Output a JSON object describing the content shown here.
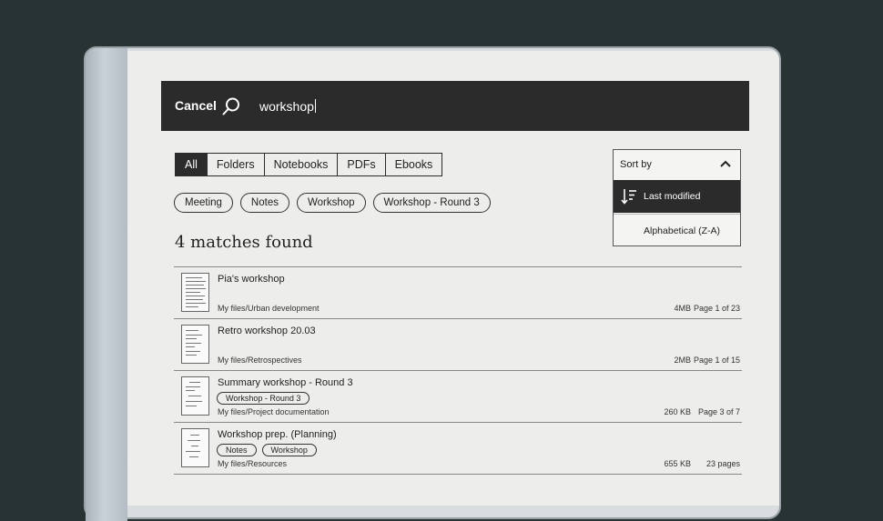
{
  "topbar": {
    "cancel_label": "Cancel",
    "search_query": "workshop"
  },
  "tabs": [
    {
      "label": "All",
      "active": true
    },
    {
      "label": "Folders",
      "active": false
    },
    {
      "label": "Notebooks",
      "active": false
    },
    {
      "label": "PDFs",
      "active": false
    },
    {
      "label": "Ebooks",
      "active": false
    }
  ],
  "chips": [
    "Meeting",
    "Notes",
    "Workshop",
    "Workshop - Round 3"
  ],
  "matches_label": "4 matches found",
  "sort": {
    "label": "Sort by",
    "options": [
      {
        "label": "Last modified",
        "selected": true
      },
      {
        "label": "Alphabetical (Z-A)",
        "selected": false
      }
    ]
  },
  "results": [
    {
      "title": "Pia's workshop",
      "tags": [],
      "path": "My files/Urban development",
      "size": "4MB",
      "pages": "Page 1 of 23"
    },
    {
      "title": "Retro workshop 20.03",
      "tags": [],
      "path": "My files/Retrospectives",
      "size": "2MB",
      "pages": "Page 1 of 15"
    },
    {
      "title": "Summary workshop - Round 3",
      "tags": [
        "Workshop - Round 3"
      ],
      "path": "My files/Project documentation",
      "size": "260 KB",
      "pages": "Page 3 of 7"
    },
    {
      "title": "Workshop prep. (Planning)",
      "tags": [
        "Notes",
        "Workshop"
      ],
      "path": "My files/Resources",
      "size": "655 KB",
      "pages": "23 pages"
    }
  ],
  "colors": {
    "background": "#273433",
    "bar": "#2b2b2b",
    "paper": "#ededeb"
  }
}
